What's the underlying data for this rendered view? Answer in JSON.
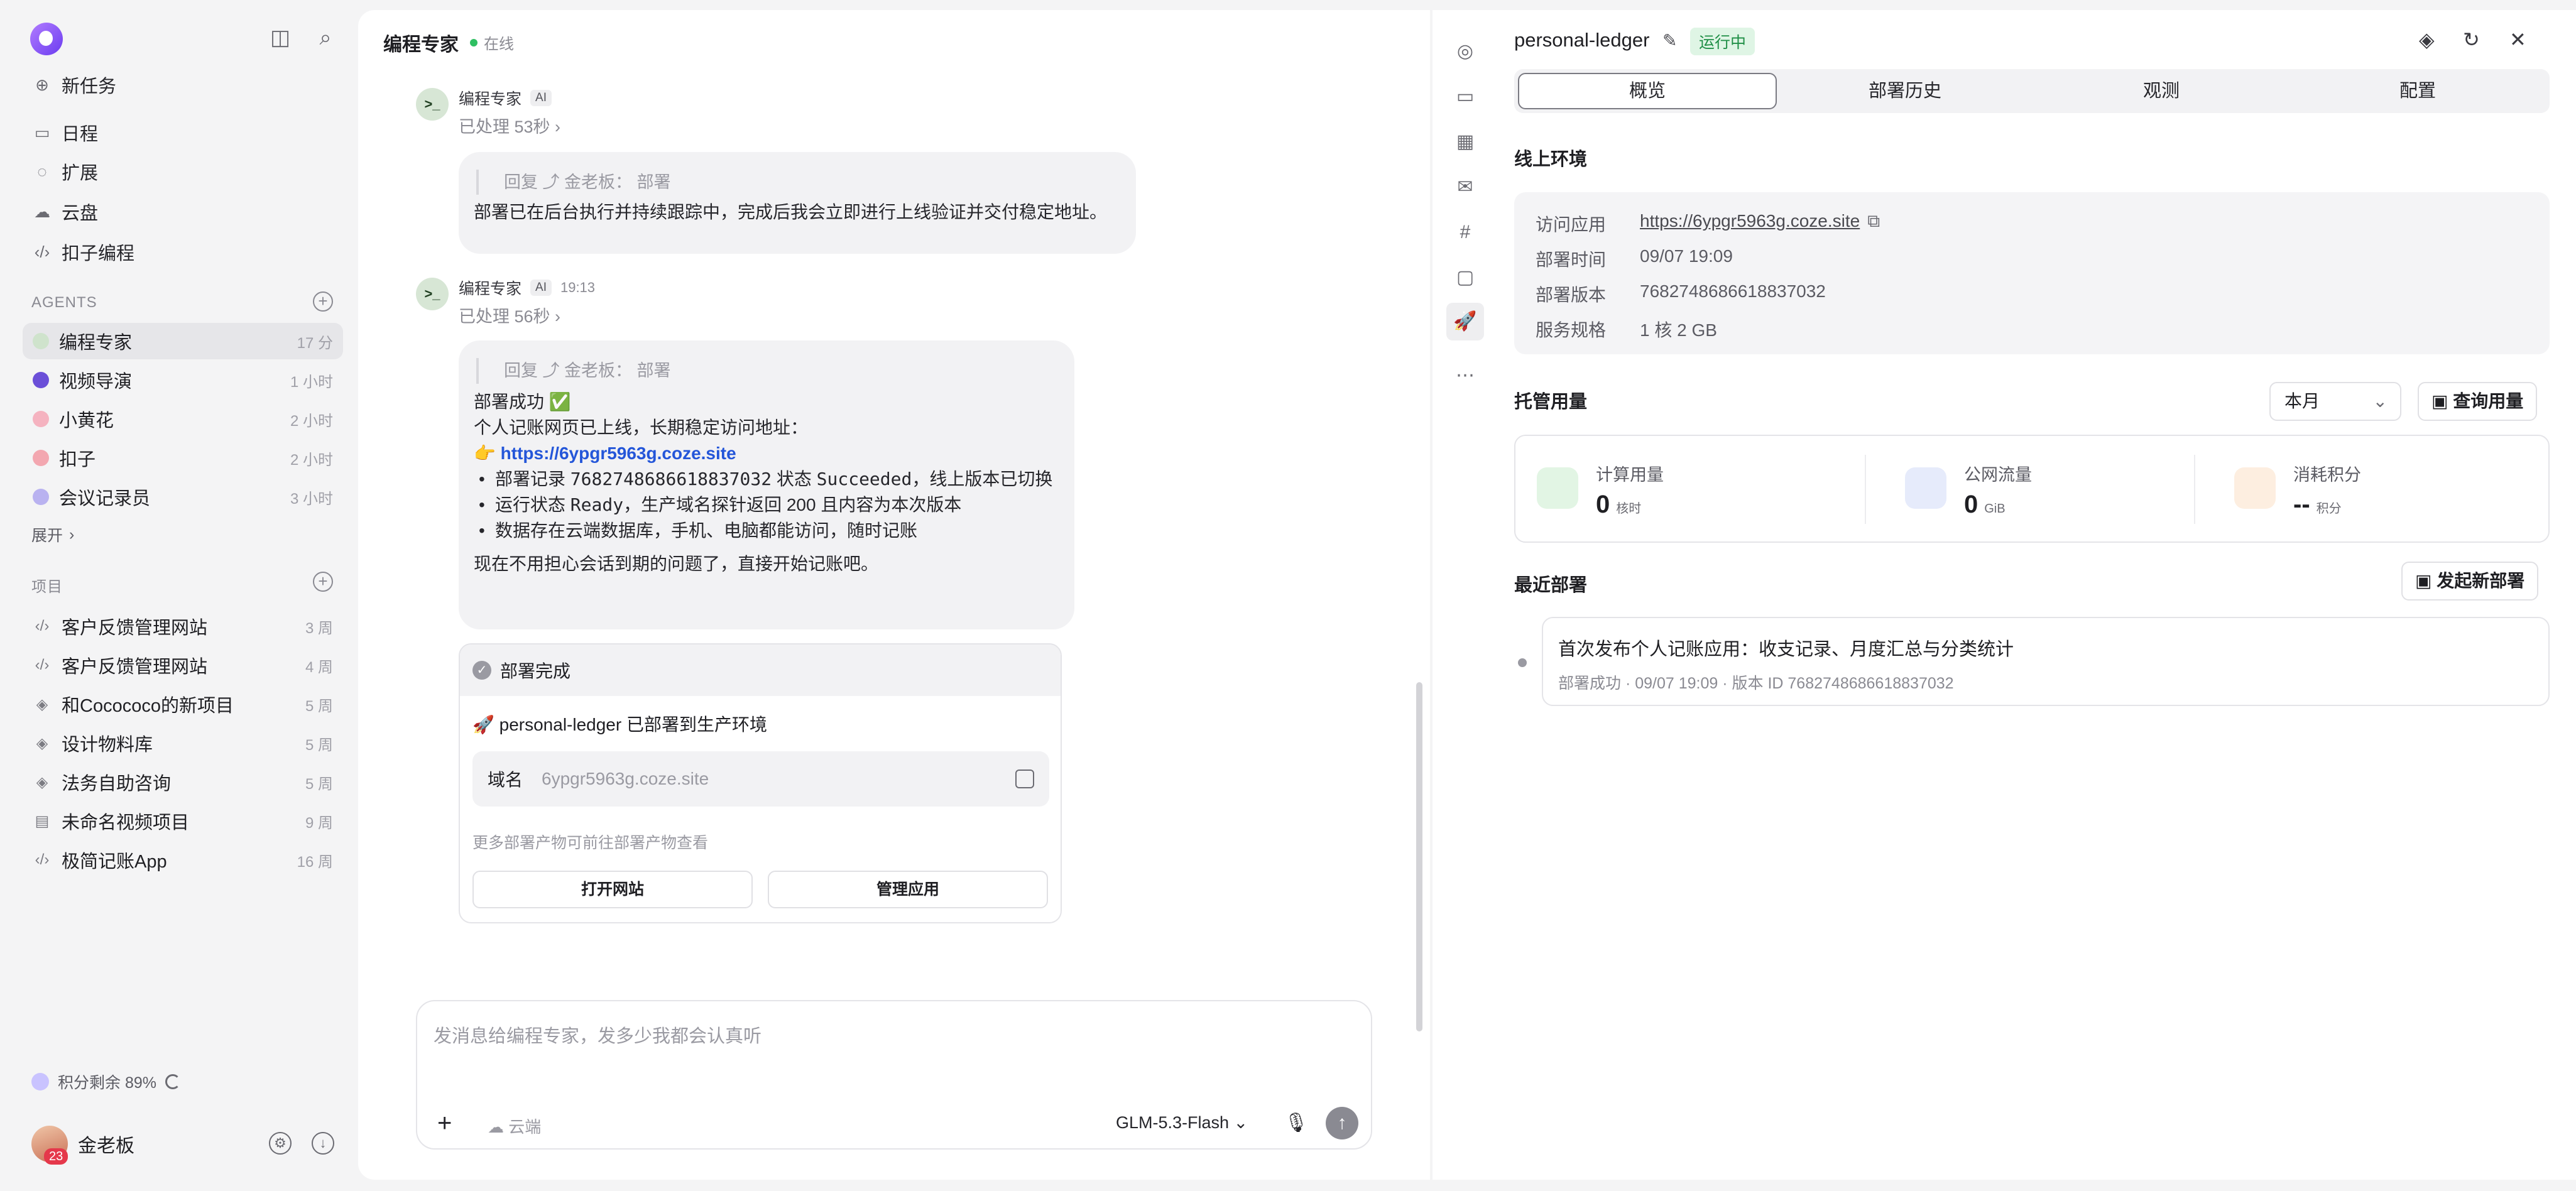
{
  "sidebar": {
    "new_task": "新任务",
    "nav": [
      {
        "label": "日程",
        "icon": "calendar-icon"
      },
      {
        "label": "扩展",
        "icon": "extension-icon"
      },
      {
        "label": "云盘",
        "icon": "cloud-icon"
      },
      {
        "label": "扣子编程",
        "icon": "code-icon"
      }
    ],
    "agents_title": "AGENTS",
    "agents": [
      {
        "name": "编程专家",
        "time": "17 分",
        "color": "#cfe3cc"
      },
      {
        "name": "视频导演",
        "time": "1 小时",
        "color": "#6b4fd8"
      },
      {
        "name": "小黄花",
        "time": "2 小时",
        "color": "#f5b3c0"
      },
      {
        "name": "扣子",
        "time": "2 小时",
        "color": "#f3a7b0"
      },
      {
        "name": "会议记录员",
        "time": "3 小时",
        "color": "#b9b2f0"
      }
    ],
    "expand": "展开",
    "projects_title": "项目",
    "projects": [
      {
        "name": "客户反馈管理网站",
        "time": "3 周",
        "icon": "code-icon"
      },
      {
        "name": "客户反馈管理网站",
        "time": "4 周",
        "icon": "code-icon"
      },
      {
        "name": "和Cocococo的新项目",
        "time": "5 周",
        "icon": "layers-icon"
      },
      {
        "name": "设计物料库",
        "time": "5 周",
        "icon": "layers-icon"
      },
      {
        "name": "法务自助咨询",
        "time": "5 周",
        "icon": "layers-icon"
      },
      {
        "name": "未命名视频项目",
        "time": "9 周",
        "icon": "film-icon"
      },
      {
        "name": "极简记账App",
        "time": "16 周",
        "icon": "code-icon"
      }
    ],
    "credits": "积分剩余 89%",
    "user_name": "金老板",
    "user_badge": "23"
  },
  "chat": {
    "title": "编程专家",
    "status": "在线",
    "bot_name": "编程专家",
    "ai_tag": "AI",
    "msg1": {
      "processed": "已处理 53秒 ›",
      "reply_quote": "回复 ⤴ 金老板： 部署",
      "text": "部署已在后台执行并持续跟踪中，完成后我会立即进行上线验证并交付稳定地址。"
    },
    "msg2": {
      "time": "19:13",
      "processed": "已处理 56秒 ›",
      "reply_quote": "回复 ⤴ 金老板： 部署",
      "line1": "部署成功 ✅",
      "line2": "个人记账网页已上线，长期稳定访问地址：",
      "link_prefix": "👉 ",
      "link": "https://6ypgr5963g.coze.site",
      "b1_pre": "部署记录 ",
      "b1_code": "7682748686618837032",
      "b1_mid": " 状态 ",
      "b1_code2": "Succeeded",
      "b1_post": "，线上版本已切换",
      "b2_pre": "运行状态 ",
      "b2_code": "Ready",
      "b2_post": "，生产域名探针返回 200 且内容为本次版本",
      "b3": "数据存在云端数据库，手机、电脑都能访问，随时记账",
      "line_end": "现在不用担心会话到期的问题了，直接开始记账吧。"
    },
    "card": {
      "title": "部署完成",
      "row1": "🚀 personal-ledger 已部署到生产环境",
      "domain_label": "域名",
      "domain_value": "6ypgr5963g.coze.site",
      "note": "更多部署产物可前往部署产物查看",
      "btn_open": "打开网站",
      "btn_manage": "管理应用"
    },
    "composer": {
      "placeholder": "发消息给编程专家，发多少我都会认真听",
      "cloud": "云端",
      "model": "GLM-5.3-Flash ⌄"
    }
  },
  "panel": {
    "app_name": "personal-ledger",
    "status": "运行中",
    "tabs": [
      "概览",
      "部署历史",
      "观测",
      "配置"
    ],
    "env_title": "线上环境",
    "env": [
      {
        "k": "访问应用",
        "v": "https://6ypgr5963g.coze.site"
      },
      {
        "k": "部署时间",
        "v": "09/07 19:09"
      },
      {
        "k": "部署版本",
        "v": "7682748686618837032"
      },
      {
        "k": "服务规格",
        "v": "1 核 2 GB"
      }
    ],
    "usage_title": "托管用量",
    "period": "本月",
    "query_btn": "查询用量",
    "usage": [
      {
        "label": "计算用量",
        "value": "0",
        "unit": "核时",
        "color": "#e2f5e4"
      },
      {
        "label": "公网流量",
        "value": "0",
        "unit": "GiB",
        "color": "#e6ebfb"
      },
      {
        "label": "消耗积分",
        "value": "--",
        "unit": "积分",
        "color": "#fdeee0"
      }
    ],
    "recent_title": "最近部署",
    "new_deploy_btn": "发起新部署",
    "deploy": {
      "title": "首次发布个人记账应用：收支记录、月度汇总与分类统计",
      "meta": "部署成功 · 09/07 19:09 · 版本 ID 7682748686618837032"
    }
  }
}
